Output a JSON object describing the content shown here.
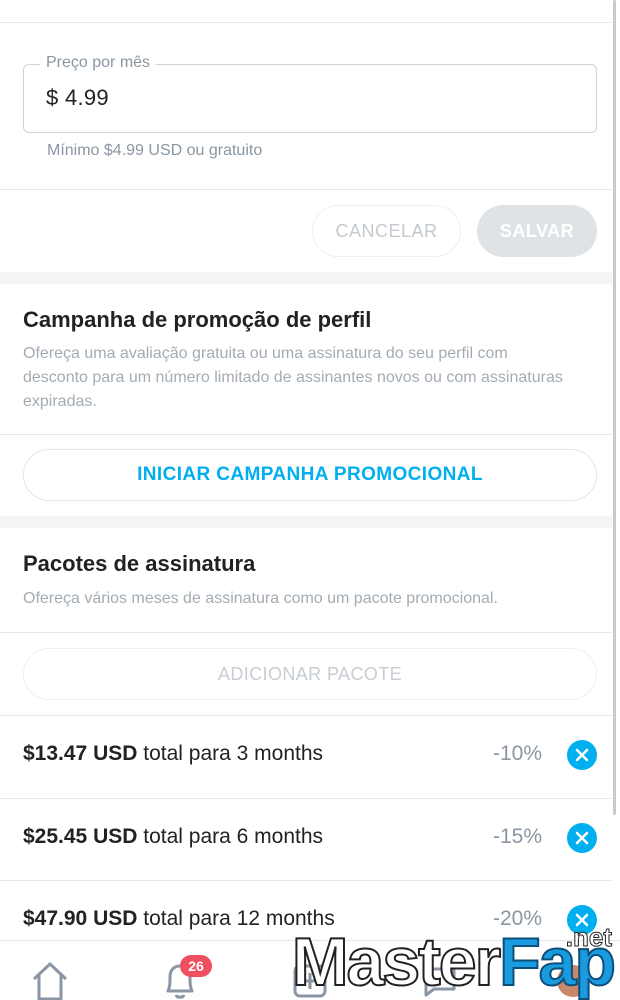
{
  "price": {
    "legend": "Preço por mês",
    "value": "$  4.99",
    "hint": "Mínimo $4.99 USD ou gratuito"
  },
  "actions": {
    "cancel_label": "CANCELAR",
    "save_label": "SALVAR"
  },
  "promotion": {
    "title": "Campanha de promoção de perfil",
    "description": "Ofereça uma avaliação gratuita ou uma assinatura do seu perfil com desconto para um número limitado de assinantes novos ou com assinaturas expiradas.",
    "button_label": "INICIAR CAMPANHA PROMOCIONAL"
  },
  "bundles": {
    "title": "Pacotes de assinatura",
    "description": "Ofereça vários meses de assinatura como um pacote promocional.",
    "add_label": "ADICIONAR PACOTE",
    "items": [
      {
        "amount": "$13.47 USD",
        "rest": " total para 3 months",
        "discount": "-10%"
      },
      {
        "amount": "$25.45 USD",
        "rest": " total para 6 months",
        "discount": "-15%"
      },
      {
        "amount": "$47.90 USD",
        "rest": " total para 12 months",
        "discount": "-20%"
      }
    ]
  },
  "nav": {
    "notifications_badge": "26",
    "icons": [
      "home-icon",
      "bell-icon",
      "add-post-icon",
      "messages-icon",
      "profile-avatar"
    ]
  },
  "watermark": {
    "part1": "Master",
    "part2": "Fap",
    "suffix": ".net"
  },
  "colors": {
    "accent": "#00aff0",
    "badge": "#ef4f5f",
    "muted_text": "#8a96a3"
  }
}
